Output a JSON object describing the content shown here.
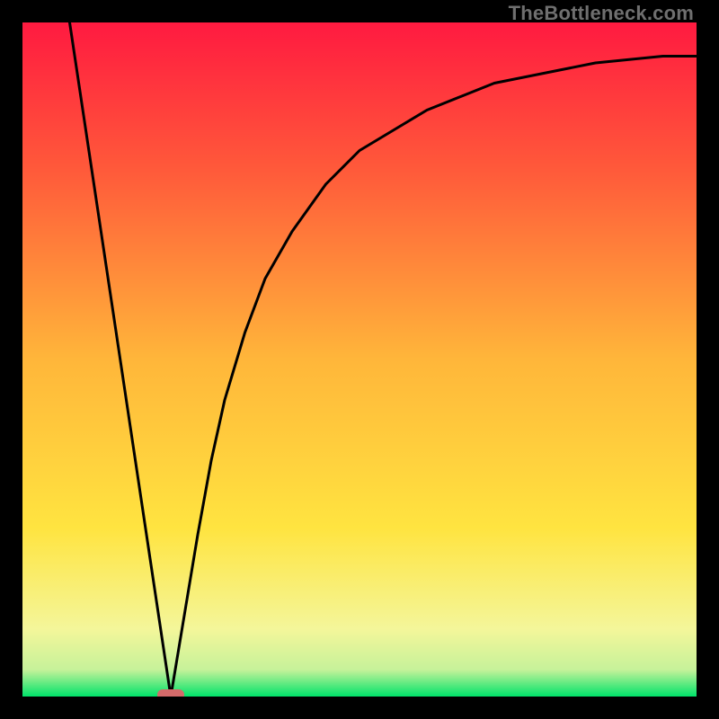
{
  "watermark": "TheBottleneck.com",
  "chart_data": {
    "type": "line",
    "title": "",
    "xlabel": "",
    "ylabel": "",
    "xlim": [
      0,
      100
    ],
    "ylim": [
      0,
      100
    ],
    "grid": false,
    "legend": false,
    "background_gradient": {
      "top_color": "#ff1a40",
      "middle_color": "#ffe440",
      "bottom_color": "#00e36a"
    },
    "marker": {
      "x": 22,
      "y": 0,
      "color": "#d46a6a",
      "shape": "pill"
    },
    "series": [
      {
        "name": "curve",
        "color": "#000000",
        "points": [
          {
            "x": 7,
            "y": 100
          },
          {
            "x": 10,
            "y": 80
          },
          {
            "x": 13,
            "y": 60
          },
          {
            "x": 16,
            "y": 40
          },
          {
            "x": 19,
            "y": 20
          },
          {
            "x": 22,
            "y": 0
          },
          {
            "x": 24,
            "y": 12
          },
          {
            "x": 26,
            "y": 24
          },
          {
            "x": 28,
            "y": 35
          },
          {
            "x": 30,
            "y": 44
          },
          {
            "x": 33,
            "y": 54
          },
          {
            "x": 36,
            "y": 62
          },
          {
            "x": 40,
            "y": 69
          },
          {
            "x": 45,
            "y": 76
          },
          {
            "x": 50,
            "y": 81
          },
          {
            "x": 55,
            "y": 84
          },
          {
            "x": 60,
            "y": 87
          },
          {
            "x": 65,
            "y": 89
          },
          {
            "x": 70,
            "y": 91
          },
          {
            "x": 75,
            "y": 92
          },
          {
            "x": 80,
            "y": 93
          },
          {
            "x": 85,
            "y": 94
          },
          {
            "x": 90,
            "y": 94.5
          },
          {
            "x": 95,
            "y": 95
          },
          {
            "x": 100,
            "y": 95
          }
        ]
      }
    ]
  }
}
